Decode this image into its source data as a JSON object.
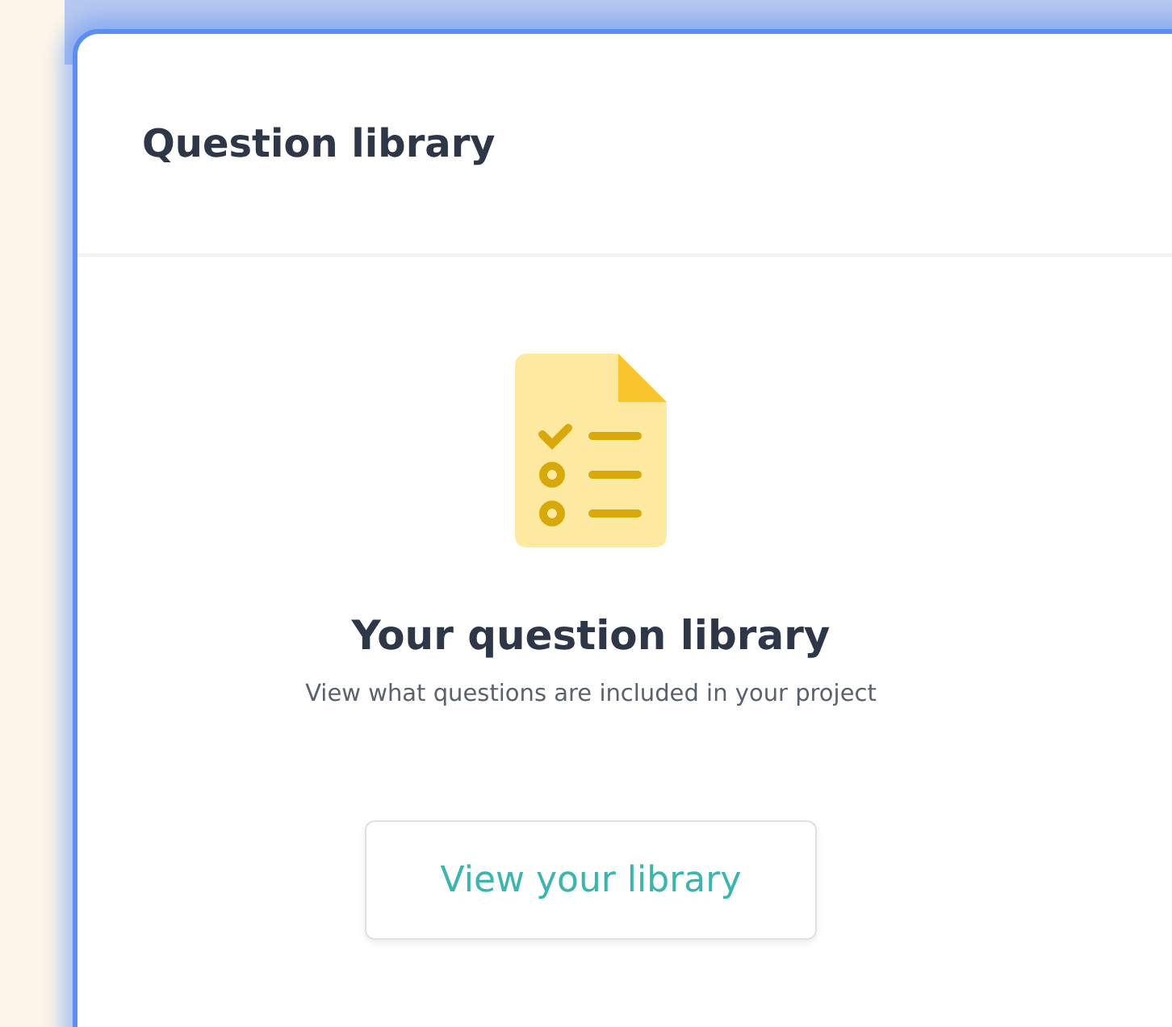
{
  "dialog": {
    "title": "Question library"
  },
  "empty_state": {
    "heading": "Your question library",
    "description": "View what questions are included in your project",
    "button": "View your library"
  }
}
